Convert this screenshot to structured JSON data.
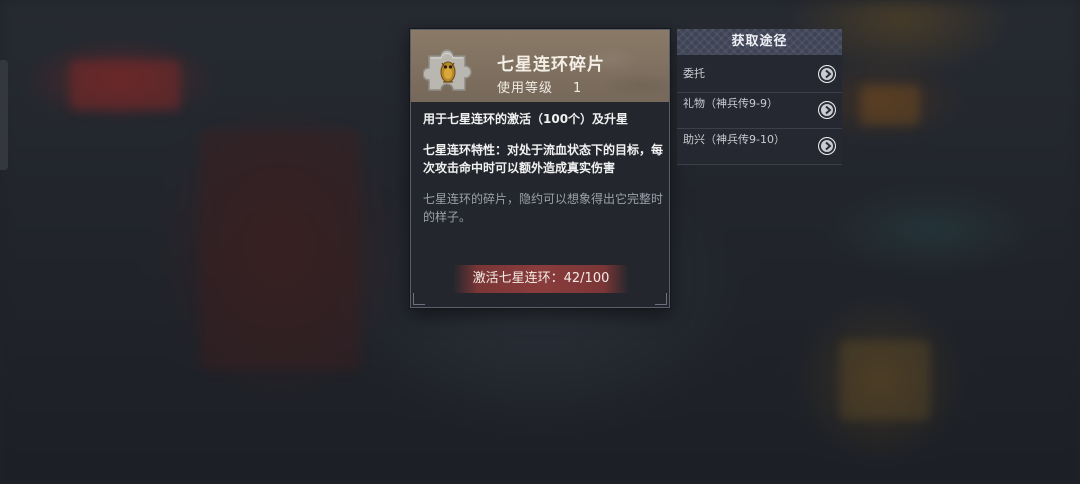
{
  "item": {
    "name": "七星连环碎片",
    "level_label": "使用等级",
    "level_value": "1",
    "icon": "jigsaw-piece-with-golden-owl-icon",
    "description": "用于七星连环的激活（100个）及升星",
    "trait": "七星连环特性：对处于流血状态下的目标，每次攻击命中时可以额外造成真实伤害",
    "flavor": "七星连环的碎片，隐约可以想象得出它完整时的样子。",
    "activate_label": "激活七星连环：42/100",
    "activate_progress": {
      "current": 42,
      "total": 100
    }
  },
  "sources": {
    "title": "获取途径",
    "items": [
      {
        "label": "委托",
        "icon": "chevron-right-icon"
      },
      {
        "label": "礼物（神兵传9-9）",
        "icon": "chevron-right-icon"
      },
      {
        "label": "助兴（神兵传9-10）",
        "icon": "chevron-right-icon"
      }
    ]
  },
  "colors": {
    "header_bg": "#7f7160",
    "card_bg": "#23262d",
    "activate_bg": "#8a3c3c",
    "source_header_bg": "#3e4456"
  }
}
